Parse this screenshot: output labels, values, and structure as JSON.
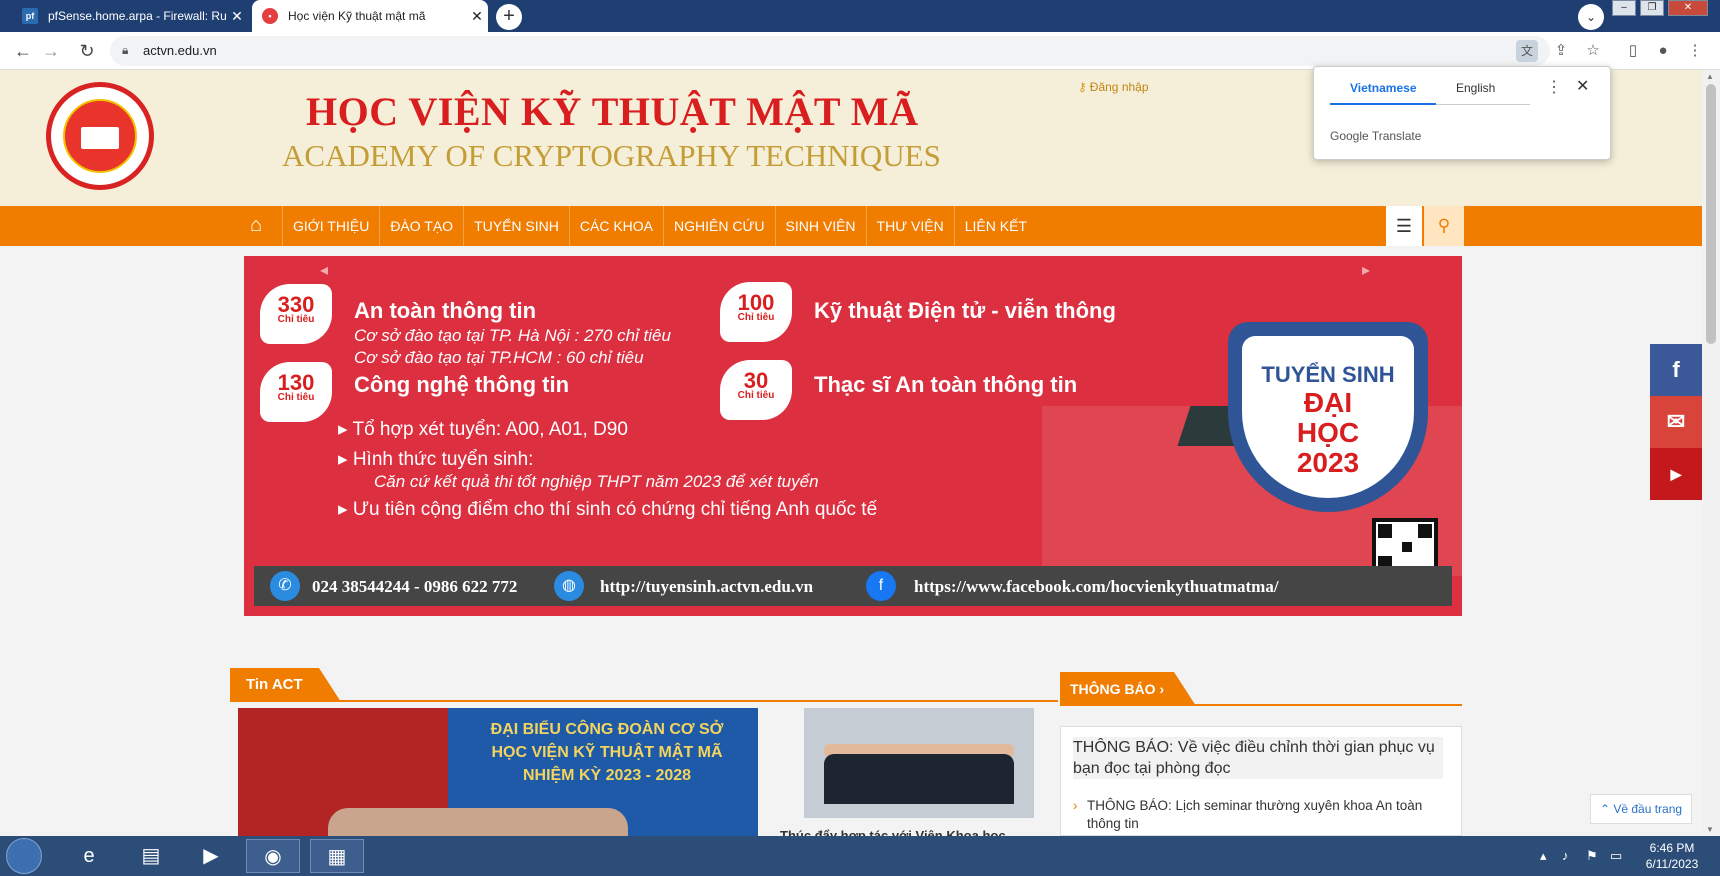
{
  "browser": {
    "tabs": [
      {
        "title": "pfSense.home.arpa - Firewall: Rul",
        "favicon": "pfsense-favicon"
      },
      {
        "title": "Học viện Kỹ thuật mật mã",
        "favicon": "actvn-favicon"
      }
    ],
    "url": "actvn.edu.vn"
  },
  "translate_popup": {
    "tab_vietnamese": "Vietnamese",
    "tab_english": "English",
    "brand": "Google Translate"
  },
  "header": {
    "title_vn": "HỌC VIỆN KỸ THUẬT MẬT MÃ",
    "title_en": "ACADEMY OF CRYPTOGRAPHY TECHNIQUES",
    "login": "Đăng nhập"
  },
  "nav": {
    "items": [
      "GIỚI THIỆU",
      "ĐÀO TẠO",
      "TUYỂN SINH",
      "CÁC KHOA",
      "NGHIÊN CỨU",
      "SINH VIÊN",
      "THƯ VIỆN",
      "LIÊN KẾT"
    ]
  },
  "banner": {
    "b1_num": "330",
    "b1_sub": "Chỉ tiêu",
    "b1_title": "An toàn thông tin",
    "b1_line1": "Cơ sở đào tạo tại TP. Hà Nội : 270 chỉ tiêu",
    "b1_line2": "Cơ sở đào tạo tại TP.HCM : 60 chỉ tiêu",
    "b2_num": "100",
    "b2_sub": "Chỉ tiêu",
    "b2_title": "Kỹ thuật Điện tử - viễn thông",
    "b3_num": "130",
    "b3_sub": "Chỉ tiêu",
    "b3_title": "Công nghệ thông tin",
    "b4_num": "30",
    "b4_sub": "Chỉ tiêu",
    "b4_title": "Thạc sĩ An toàn thông tin",
    "bullet1": "▸ Tổ hợp xét tuyển: A00, A01, D90",
    "bullet2": "▸ Hình thức tuyển sinh:",
    "bullet2_detail": "Căn cứ kết quả thi tốt nghiệp THPT năm 2023 để xét tuyển",
    "bullet3": "▸ Ưu tiên cộng điểm cho thí sinh có chứng chỉ tiếng Anh quốc tế",
    "shield_line1": "TUYỂN SINH",
    "shield_line2": "ĐẠI",
    "shield_line3": "HỌC",
    "shield_line4": "2023",
    "footer_phone": "024 38544244 - 0986 622 772",
    "footer_web": "http://tuyensinh.actvn.edu.vn",
    "footer_fb": "https://www.facebook.com/hocvienkythuatmatma/"
  },
  "news": {
    "section_title": "Tin ACT",
    "main_headline": "ĐẠI BIỂU CÔNG ĐOÀN CƠ SỞ HỌC VIỆN KỸ THUẬT MẬT MÃ NHIỆM KỲ 2023 - 2028",
    "side_caption": "Thúc đẩy hợp tác với Viện Khoa học"
  },
  "notices": {
    "section_title": "THÔNG BÁO ›",
    "main": "THÔNG BÁO: Về việc điều chỉnh thời gian phục vụ bạn đọc tại phòng đọc",
    "item1": "THÔNG BÁO: Lịch seminar thường xuyên khoa An toàn thông tin"
  },
  "back_to_top": "Về đầu trang",
  "taskbar": {
    "time": "6:46 PM",
    "date": "6/11/2023"
  },
  "colors": {
    "nav_orange": "#f07c00",
    "title_red": "#d81e1e",
    "banner_red": "#dc2f3f",
    "facebook": "#3b5998",
    "mail": "#d9443a",
    "youtube": "#c4191c"
  }
}
